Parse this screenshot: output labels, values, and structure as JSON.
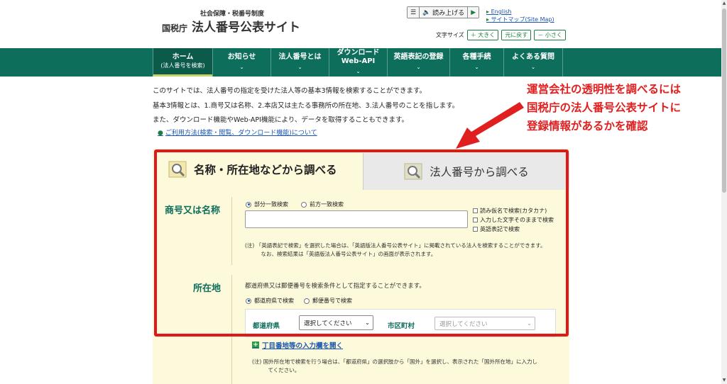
{
  "header": {
    "logo_small": "社会保障・税番号制度",
    "logo_prefix": "国税庁",
    "logo_main": "法人番号公表サイト",
    "read_button": "読み上げる",
    "links": [
      "English",
      "サイトマップ(Site Map)"
    ],
    "font_size_label": "文字サイズ",
    "font_size_buttons": [
      "＋ 大きく",
      "元に戻す",
      "－ 小さく"
    ]
  },
  "nav": {
    "items": [
      {
        "label": "ホーム",
        "sub": "(法人番号を検索)"
      },
      {
        "label": "お知らせ",
        "sub": ""
      },
      {
        "label": "法人番号とは",
        "sub": ""
      },
      {
        "label": "ダウンロード",
        "sub": "Web-API"
      },
      {
        "label": "英語表記の登録",
        "sub": ""
      },
      {
        "label": "各種手続",
        "sub": ""
      },
      {
        "label": "よくある質問",
        "sub": ""
      }
    ]
  },
  "intro": {
    "lines": [
      "このサイトでは、法人番号の指定を受けた法人等の基本3情報を検索することができます。",
      "基本3情報とは、1.商号又は名称、2.本店又は主たる事務所の所在地、3.法人番号のことを指します。",
      "また、ダウンロード機能やWeb-API機能により、データを取得することもできます。"
    ],
    "link": "ご利用方法(検索・閲覧、ダウンロード機能)について"
  },
  "annotation": {
    "lines": [
      "運営会社の透明性を調べるには",
      "国税庁の法人番号公表サイトに",
      "登録情報があるかを確認"
    ],
    "color": "#e02020"
  },
  "search": {
    "tab1": "名称・所在地などから調べる",
    "tab2": "法人番号から調べる",
    "name_label": "商号又は名称",
    "match_options": [
      "部分一致検索",
      "前方一致検索"
    ],
    "name_value": "",
    "checkboxes": [
      "読み仮名で検索(カタカナ)",
      "入力した文字そのままで検索",
      "英語表記で検索"
    ],
    "note1": [
      "(注) 「英語表記で検索」を選択した場合は、「英語版法人番号公表サイト」に掲載されている法人を検索することができます。",
      "　　　なお、検索結果は「英語版法人番号公表サイト」の画面が表示されます。"
    ],
    "location_label": "所在地",
    "location_desc": "都道府県又は郵便番号を検索条件として指定することができます。",
    "location_options": [
      "都道府県で検索",
      "郵便番号で検索"
    ],
    "pref_label": "都道府県",
    "pref_value": "選択してください",
    "city_label": "市区町村",
    "city_value": "選択してください",
    "expand_link": "丁目番地等の入力欄を開く",
    "note2": [
      "(注) 国外所在地で検索を行う場合は、「都道府県」の選択肢から「国外」を選択し、表示された「国外所在地」に入力し",
      "　　　てください。"
    ]
  },
  "colors": {
    "nav": "#0e6e5c",
    "panel": "#fdf9db",
    "highlight": "#e01818"
  }
}
